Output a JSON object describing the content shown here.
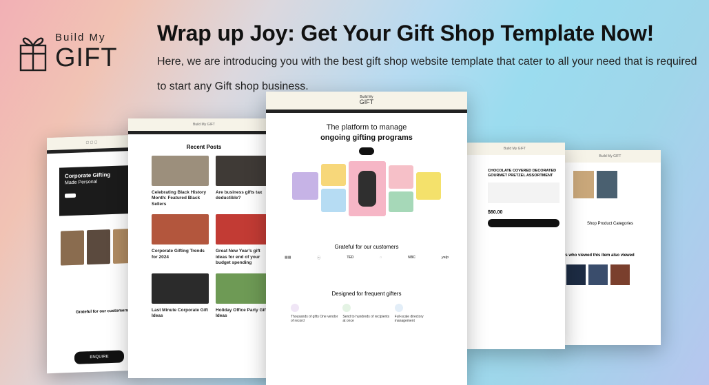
{
  "brand": {
    "top": "Build My",
    "bottom": "GIFT"
  },
  "headline": "Wrap up Joy: Get Your Gift Shop Template Now!",
  "subline": "Here, we are introducing you with the best gift shop website template that cater to all your need that is required to start any Gift shop business.",
  "far_left": {
    "hero_title": "Corporate Gifting",
    "hero_sub": "Made Personal",
    "customers": "Grateful for our customers",
    "cta": "ENQUIRE"
  },
  "left": {
    "posts_title": "Recent Posts",
    "posts": [
      {
        "title": "Celebrating Black History Month: Featured Black Sellers"
      },
      {
        "title": "Are business gifts tax deductible?"
      },
      {
        "title": "Corporate Gifting Trends for 2024"
      },
      {
        "title": "Great New Year's gift ideas for end of your budget spending"
      },
      {
        "title": "Last Minute Corporate Gift Ideas"
      },
      {
        "title": "Holiday Office Party Gift Ideas"
      }
    ]
  },
  "center": {
    "brand_top": "Build My",
    "brand_bottom": "GIFT",
    "hero_line1": "The platform to manage",
    "hero_line2": "ongoing gifting programs",
    "customers_title": "Grateful for our customers",
    "customer_logos": [
      "TED",
      "NBC",
      "yelp"
    ],
    "designed_title": "Designed for frequent gifters",
    "features": [
      {
        "title": "Thousands of gifts One vendor of record"
      },
      {
        "title": "Send to hundreds of recipients at once"
      },
      {
        "title": "Full-scale directory management"
      }
    ]
  },
  "right": {
    "product_title": "CHOCOLATE COVERED DECORATED GOURMET PRETZEL ASSORTMENT",
    "price": "$60.00"
  },
  "far_right": {
    "categories_title": "Shop Product Categories",
    "viewed_title": "rs who viewed this item also viewed"
  },
  "colors": {
    "accent": "#111111",
    "cream": "#f6f3e8"
  }
}
